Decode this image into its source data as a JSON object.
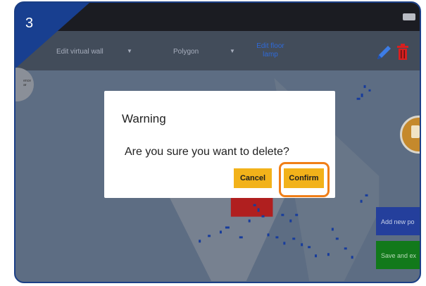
{
  "step": {
    "number": "3"
  },
  "toolbar": {
    "edit_virtual_wall": "Edit virtual wall",
    "polygon": "Polygon",
    "edit_floor_lamp": "Edit floor lamp"
  },
  "dialog": {
    "title": "Warning",
    "message": "Are you sure you want to delete?",
    "cancel_label": "Cancel",
    "confirm_label": "Confirm"
  },
  "side_buttons": {
    "add_new": "Add new po",
    "save_and": "Save and ex"
  },
  "colors": {
    "accent": "#f2b21a",
    "highlight": "#f07f18",
    "badge": "#183f90"
  }
}
